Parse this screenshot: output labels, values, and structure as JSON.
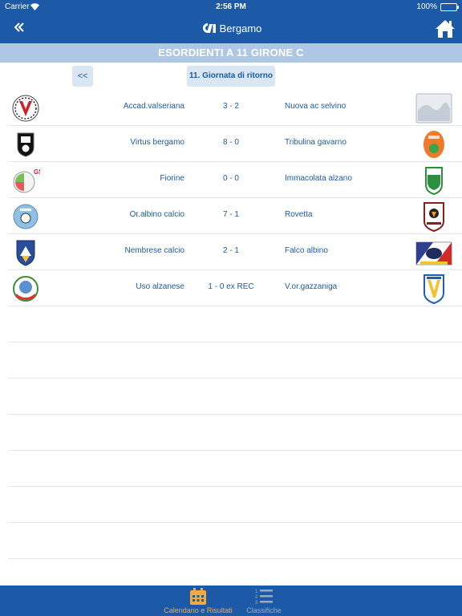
{
  "status_bar": {
    "carrier": "Carrier",
    "time": "2:56 PM",
    "battery": "100%"
  },
  "nav": {
    "back_icon": "double-chevron-left-icon",
    "title": "Bergamo",
    "home_icon": "home-icon"
  },
  "section": {
    "title": "ESORDIENTI A 11 GIRONE C"
  },
  "round": {
    "prev_label": "<<",
    "label": "11. Giornata di ritorno"
  },
  "matches": [
    {
      "home": "Accad.valseriana",
      "score": "3 - 2",
      "away": "Nuova ac selvino"
    },
    {
      "home": "Virtus bergamo",
      "score": "8 - 0",
      "away": "Tribulina gavarno"
    },
    {
      "home": "Fiorine",
      "score": "0 - 0",
      "away": "Immacolata alzano"
    },
    {
      "home": "Or.albino calcio",
      "score": "7 - 1",
      "away": "Rovetta"
    },
    {
      "home": "Nembrese calcio",
      "score": "2 - 1",
      "away": "Falco albino"
    },
    {
      "home": "Uso alzanese",
      "score": "1 - 0 ex REC",
      "away": "V.or.gazzaniga"
    }
  ],
  "tabs": [
    {
      "label": "Calendario e Risultati",
      "icon": "calendar-icon",
      "active": true
    },
    {
      "label": "Classifiche",
      "icon": "numbered-list-icon",
      "active": false
    }
  ],
  "colors": {
    "primary": "#1c5aa8",
    "section_header": "#aec7e4",
    "button_bg": "#d9e6f4",
    "active_tab": "#f3a93b",
    "inactive_tab": "#9aa9bd"
  }
}
